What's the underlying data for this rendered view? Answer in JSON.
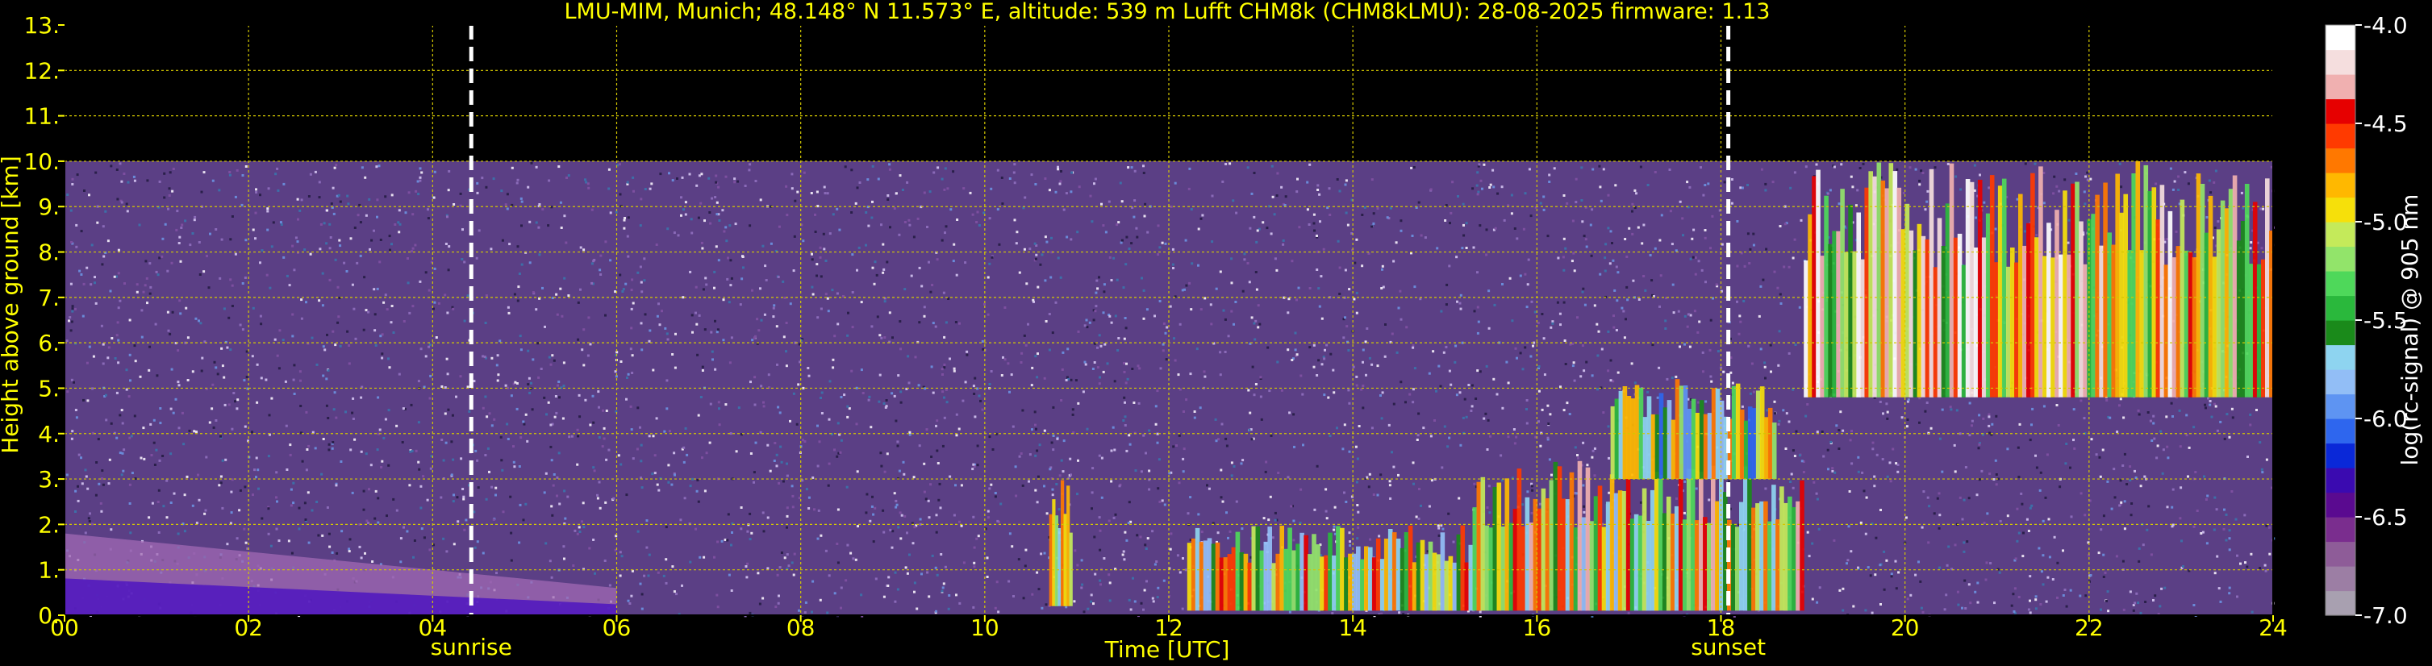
{
  "chart_data": {
    "type": "heatmap",
    "title": "LMU-MIM, Munich; 48.148° N 11.573° E, altitude: 539 m    Lufft CHM8k (CHM8kLMU): 28-08-2025    firmware: 1.13",
    "xlabel": "Time [UTC]",
    "ylabel": "Height above ground [km]",
    "xlim": [
      0,
      24
    ],
    "ylim": [
      0,
      13
    ],
    "x_ticks": [
      "00",
      "02",
      "04",
      "06",
      "08",
      "10",
      "12",
      "14",
      "16",
      "18",
      "20",
      "22",
      "24"
    ],
    "y_ticks": [
      "0.",
      "1.",
      "2.",
      "3.",
      "4.",
      "5.",
      "6.",
      "7.",
      "8.",
      "9.",
      "10.",
      "11.",
      "12.",
      "13."
    ],
    "grid": true,
    "measurement_top_km": 10.0,
    "events": [
      {
        "label": "sunrise",
        "time": 4.42
      },
      {
        "label": "sunset",
        "time": 18.08
      }
    ],
    "colorbar": {
      "label": "log(rc-signal) @ 905 nm",
      "range": [
        -7.0,
        -4.0
      ],
      "ticks": [
        "-7.0",
        "-6.5",
        "-6.0",
        "-5.5",
        "-5.0",
        "-4.5",
        "-4.0"
      ],
      "colors": [
        "#a8a0b0",
        "#9c7ea4",
        "#8e5c98",
        "#7a2d8e",
        "#5a0a90",
        "#3a0ab0",
        "#0a28d8",
        "#2e66ee",
        "#5e94f2",
        "#92bef6",
        "#8ed4f0",
        "#1a8a1a",
        "#2ab83c",
        "#4ed85a",
        "#92e46a",
        "#c4ea5a",
        "#f6e00a",
        "#ffb800",
        "#ff7800",
        "#ff3a00",
        "#e60000",
        "#f0b0b0",
        "#f5dede",
        "#ffffff"
      ]
    },
    "background_color": "#5b3f85",
    "features": [
      {
        "kind": "aerosol_layer",
        "t_start": 0.0,
        "t_end": 6.0,
        "top_km": [
          1.8,
          0.6
        ],
        "level": -6.6
      },
      {
        "kind": "cloud",
        "t_start": 10.7,
        "t_end": 10.95,
        "base_km": 0.2,
        "top_km": 3.1,
        "level": -5.0
      },
      {
        "kind": "cloud",
        "t_start": 12.2,
        "t_end": 15.3,
        "base_km": 0.1,
        "top_km": 2.0,
        "level": -5.2
      },
      {
        "kind": "cloud",
        "t_start": 15.3,
        "t_end": 18.9,
        "base_km": 0.1,
        "top_km": 3.4,
        "level": -5.0
      },
      {
        "kind": "cloud",
        "t_start": 16.8,
        "t_end": 18.6,
        "base_km": 3.0,
        "top_km": 5.2,
        "level": -5.3
      },
      {
        "kind": "cirrus",
        "t_start": 18.9,
        "t_end": 24.0,
        "base_km": 4.8,
        "top_km": 10.0,
        "level": -4.8
      }
    ]
  }
}
